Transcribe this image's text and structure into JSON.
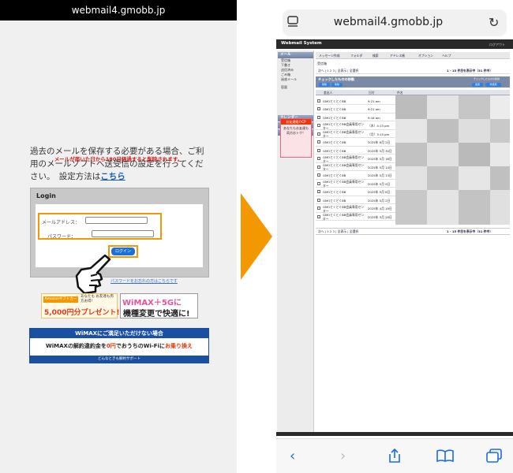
{
  "left_phone": {
    "url": "webmail4.gmobb.jp",
    "warning": "メールが届いた日から180日経過すると削除されます。",
    "info_text": "過去のメールを保存する必要がある場合、ご利用のメールソフトへ送受信の設定を行ってください。　設定方法は",
    "info_link": "こちら",
    "login": {
      "title": "Login",
      "mail_label": "メールアドレス：",
      "password_label": "パスワード：",
      "button": "ログイン",
      "forgot": "パスワードをお忘れの方はこちらです"
    },
    "banner_amazon": {
      "gift_label": "Amazonギフトカード",
      "small": "あなたも お友達も両方お得！",
      "big": "5,000円分プレゼント!"
    },
    "banner_wimax": {
      "line1": "WiMAX＋5Gに",
      "line2": "機種変更で快適に!"
    },
    "banner_cancel": {
      "head": "WiMAXにご満足いただけない場合",
      "body_pre": "WiMAXの解約違約金を",
      "body_zero": "0円",
      "body_mid": "で",
      "body_service": "おうちのWi-Fi",
      "body_ni": "に",
      "body_tag": "お乗り換え",
      "foot": "どんなときも解約サポート"
    }
  },
  "right_phone": {
    "url": "webmail4.gmobb.jp",
    "webmail": {
      "title": "Webmail System",
      "logout": "ログアウト",
      "sidebar": {
        "mail_head": "メール",
        "folders": [
          "受信箱",
          "下書き",
          "送信済み",
          "ごみ箱",
          "迷惑メール"
        ],
        "quota": "容量",
        "calendar": "カレンダー",
        "address": "アドレス帳",
        "memo": "メモ",
        "ad_head": "お友達紹介CP",
        "ad_text": "あなたもお友達も 両方おトク！"
      },
      "toolbar": [
        "メッセージ作成",
        "フォルダ",
        "検索",
        "アドレス帳",
        "オプション",
        "ヘルプ"
      ],
      "folder_title": "受信箱",
      "pager": "次へ | 1 2 3 | 全表示 | 全選択",
      "count": "1 - 15 件目を表示中（31 件中）",
      "move_title": "チェックしたものの移動",
      "move_right": "チェックしたものの削除",
      "pills": [
        "移動",
        "削除",
        "迷惑",
        "非迷惑"
      ],
      "headers": [
        "差出人",
        "日付",
        "件名"
      ],
      "rows": [
        {
          "from": "GMOとくとくBB",
          "date": "9:21 am"
        },
        {
          "from": "GMOとくとくBB",
          "date": "9:21 am"
        },
        {
          "from": "GMOとくとくBB",
          "date": "9:18 am"
        },
        {
          "from": "GMOとくとくBB会員専用センター",
          "date": "（木）4:13 pm"
        },
        {
          "from": "GMOとくとくBB会員専用センター",
          "date": "（月）3:15 pm"
        },
        {
          "from": "GMOとくとくBB",
          "date": "2025年 6月 2日"
        },
        {
          "from": "GMOとくとくBB",
          "date": "2025年 5月 30日"
        },
        {
          "from": "GMOとくとくBB会員専用センター",
          "date": "2025年 5月 16日"
        },
        {
          "from": "GMOとくとくBB会員専用センター",
          "date": "2025年 5月 14日"
        },
        {
          "from": "GMOとくとくBB",
          "date": "2025年 5月 13日"
        },
        {
          "from": "GMOとくとくBB会員専用センター",
          "date": "2025年 5月 9日"
        },
        {
          "from": "GMOとくとくBB",
          "date": "2025年 5月 8日"
        },
        {
          "from": "GMOとくとくBB",
          "date": "2025年 5月 2日"
        },
        {
          "from": "GMOとくとくBB会員専用センター",
          "date": "2025年 4月 19日"
        },
        {
          "from": "GMOとくとくBB会員専用センター",
          "date": "2025年 3月 28日"
        }
      ]
    }
  },
  "colors": {
    "accent_orange": "#f39800",
    "link_blue": "#1a5fb4",
    "safari_blue": "#1a6ae6"
  }
}
